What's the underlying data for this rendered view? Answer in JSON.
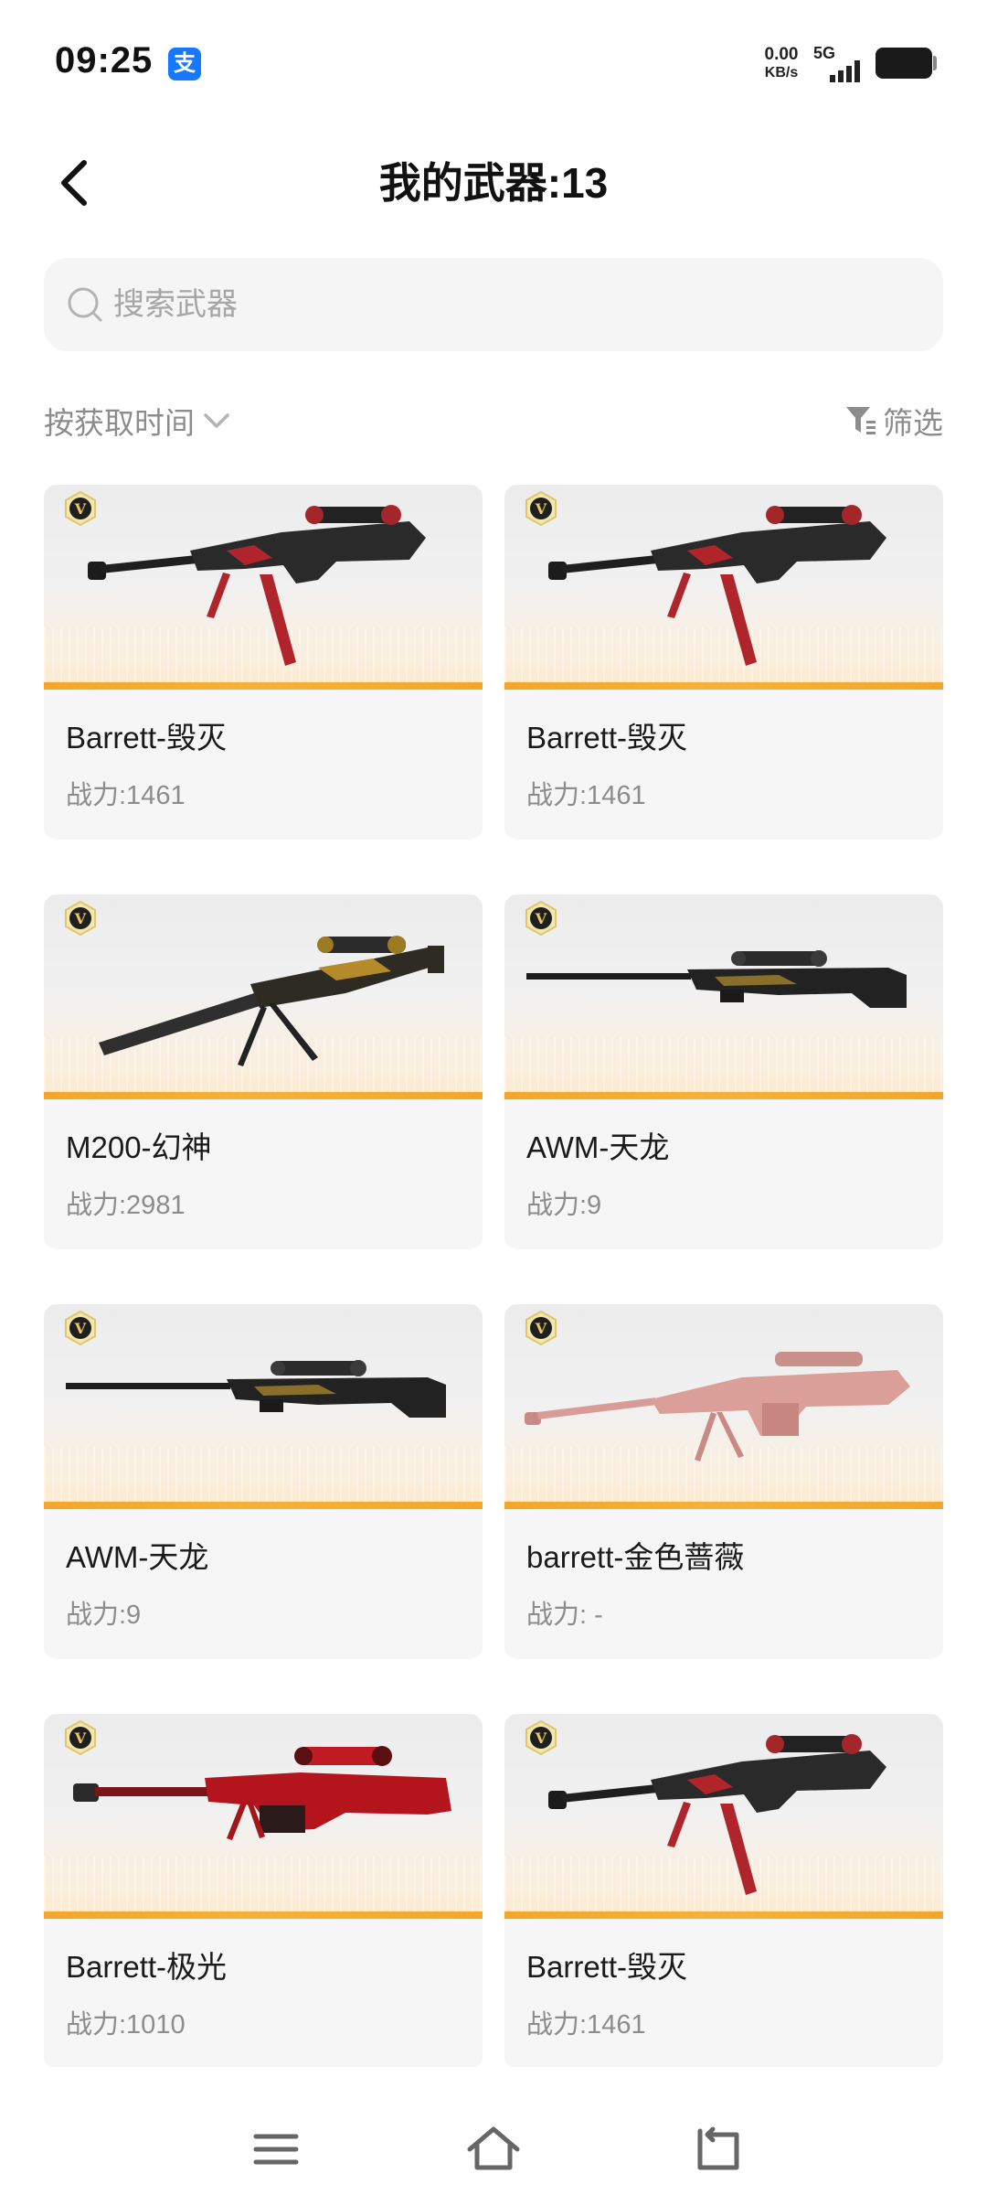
{
  "status_bar": {
    "time": "09:25",
    "app_badge": "支",
    "net_speed_value": "0.00",
    "net_speed_unit": "KB/s",
    "network": "5G",
    "accent_alipay": "#1677ff"
  },
  "header": {
    "title": "我的武器:13",
    "back_icon": "chevron-left-icon"
  },
  "search": {
    "placeholder": "搜索武器",
    "value": ""
  },
  "toolbar": {
    "sort_label": "按获取时间",
    "filter_label": "筛选"
  },
  "weapons": [
    {
      "name": "Barrett-毁灭",
      "power": "战力:1461",
      "style": "barrett-destroy"
    },
    {
      "name": "Barrett-毁灭",
      "power": "战力:1461",
      "style": "barrett-destroy"
    },
    {
      "name": "M200-幻神",
      "power": "战力:2981",
      "style": "m200"
    },
    {
      "name": "AWM-天龙",
      "power": "战力:9",
      "style": "awm"
    },
    {
      "name": "AWM-天龙",
      "power": "战力:9",
      "style": "awm"
    },
    {
      "name": "barrett-金色蔷薇",
      "power": "战力: -",
      "style": "barrett-rose"
    },
    {
      "name": "Barrett-极光",
      "power": "战力:1010",
      "style": "barrett-aurora"
    },
    {
      "name": "Barrett-毁灭",
      "power": "战力:1461",
      "style": "barrett-destroy"
    }
  ],
  "vip_badge_letter": "V",
  "colors": {
    "card_bg": "#f6f6f6",
    "accent_orange": "#f4a62a",
    "secondary_text": "#8c8c8c"
  },
  "nav": {
    "icons": [
      "menu-icon",
      "home-icon",
      "back-icon"
    ]
  }
}
